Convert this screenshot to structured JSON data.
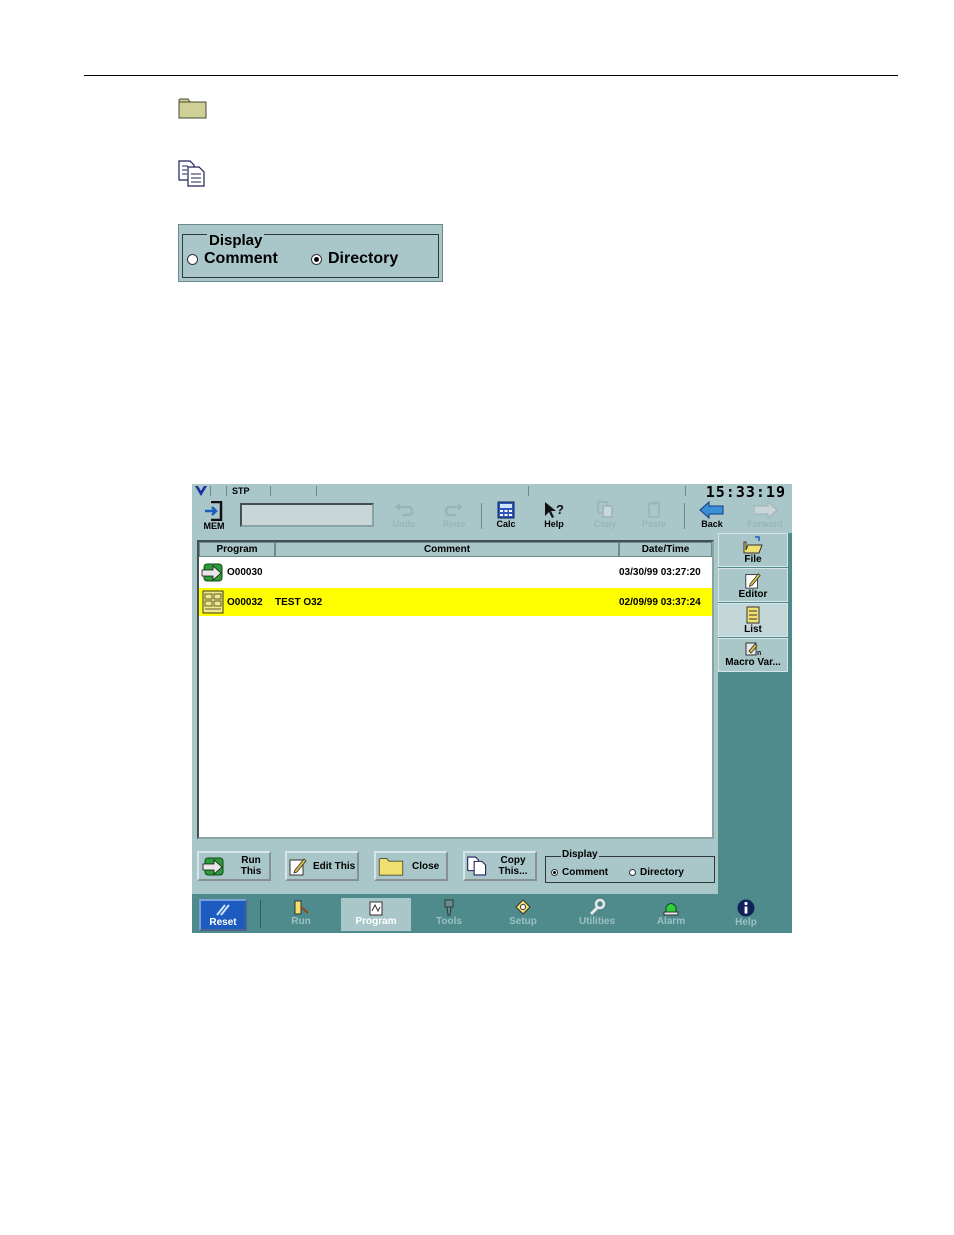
{
  "illustration": {
    "display_group": {
      "legend": "Display",
      "options": [
        {
          "label": "Comment",
          "selected": false
        },
        {
          "label": "Directory",
          "selected": true
        }
      ]
    }
  },
  "screen": {
    "status": {
      "mode": "STP",
      "time": "15:33:19"
    },
    "toolbar": {
      "mem_label": "MEM",
      "undo_label": "Undo",
      "redo_label": "Redo",
      "calc_label": "Calc",
      "help_label": "Help",
      "copy_label": "Copy",
      "paste_label": "Paste",
      "back_label": "Back",
      "forward_label": "Forward"
    },
    "list": {
      "columns": [
        "Program",
        "Comment",
        "Date/Time"
      ],
      "rows": [
        {
          "program": "O00030",
          "comment": "",
          "datetime": "03/30/99 03:27:20",
          "selected": false
        },
        {
          "program": "O00032",
          "comment": "TEST O32",
          "datetime": "02/09/99 03:37:24",
          "selected": true
        }
      ]
    },
    "buttons": {
      "run_this": "Run This",
      "edit_this": "Edit This",
      "close": "Close",
      "copy_this": "Copy This..."
    },
    "display_group": {
      "legend": "Display",
      "options": [
        {
          "label": "Comment",
          "selected": true
        },
        {
          "label": "Directory",
          "selected": false
        }
      ]
    },
    "side_tabs": [
      "File",
      "Editor",
      "List",
      "Macro Var..."
    ],
    "nav": {
      "reset_label": "Reset",
      "items": [
        "Run",
        "Program",
        "Tools",
        "Setup",
        "Utilities",
        "Alarm",
        "Help"
      ],
      "active": "Program"
    },
    "colors": {
      "panel": "#a9c6c9",
      "background": "#4f8a8c",
      "selection": "#ffff00",
      "reset": "#1c5bbf"
    }
  }
}
